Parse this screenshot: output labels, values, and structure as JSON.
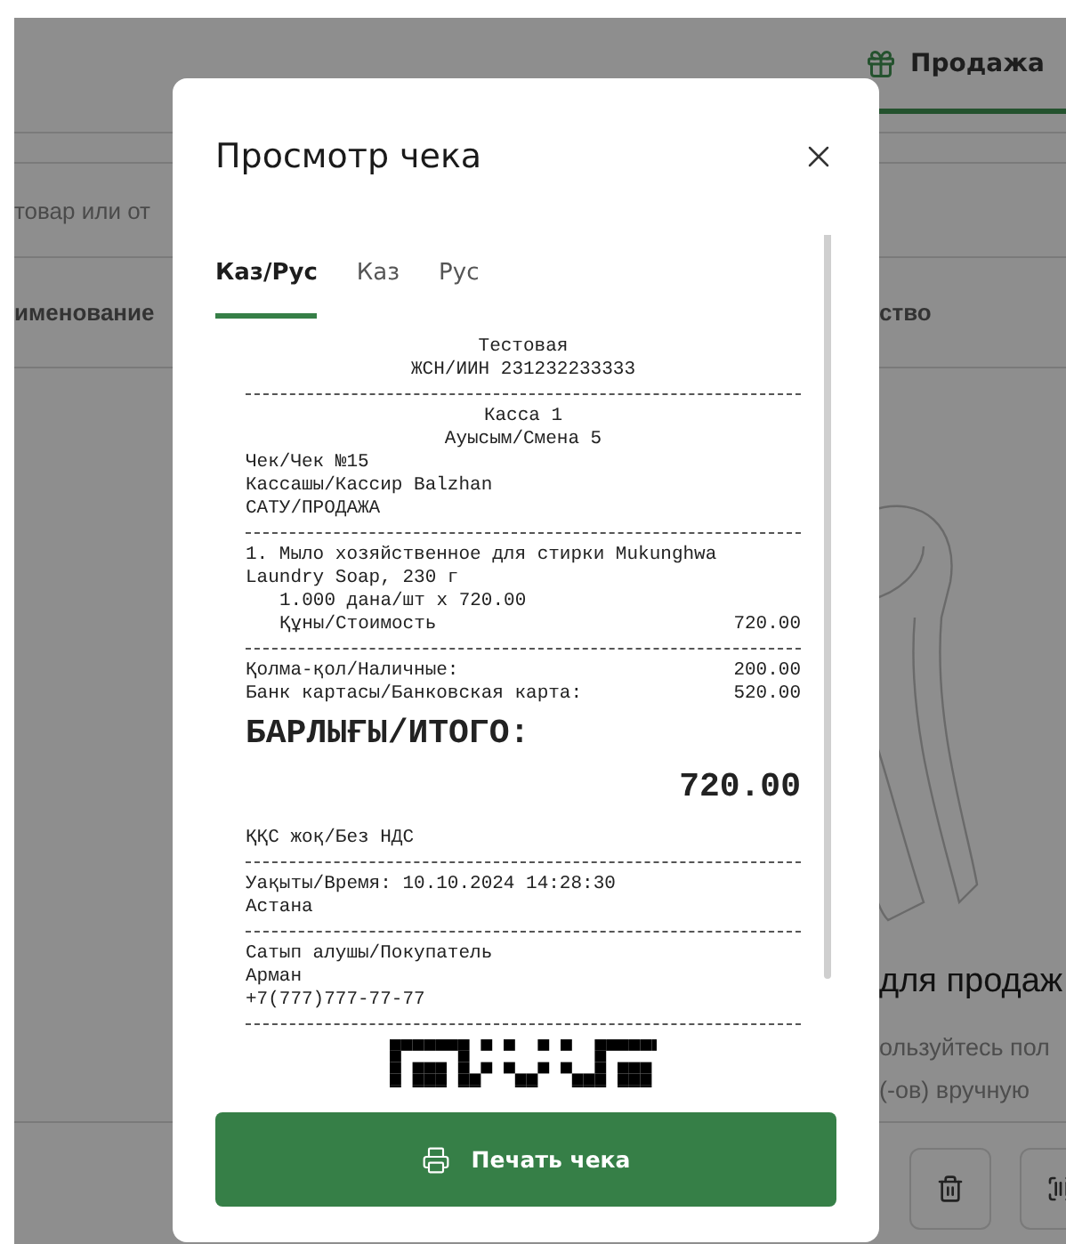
{
  "background": {
    "nav_tab": {
      "label": "Продажа",
      "selected": true
    },
    "search": {
      "placeholder": "товар или от"
    },
    "table": {
      "columns": [
        "именование",
        "ство"
      ]
    },
    "empty_state": {
      "title": "для продаж",
      "lines": [
        "ользуйтесь пол",
        "(-ов) вручную"
      ]
    }
  },
  "dialog": {
    "title": "Просмотр чека",
    "tabs": [
      {
        "label": "Каз/Рус",
        "selected": true
      },
      {
        "label": "Каз",
        "selected": false
      },
      {
        "label": "Рус",
        "selected": false
      }
    ],
    "receipt": [
      {
        "kind": "center",
        "text": "Тестовая"
      },
      {
        "kind": "center",
        "text": "ЖСН/ИИН 231232233333"
      },
      {
        "kind": "divider"
      },
      {
        "kind": "center",
        "text": "Касса 1"
      },
      {
        "kind": "center",
        "text": "Ауысым/Смена 5"
      },
      {
        "kind": "text",
        "text": "Чек/Чек №15"
      },
      {
        "kind": "text",
        "text": "Кассашы/Кассир Balzhan"
      },
      {
        "kind": "text",
        "text": "САТУ/ПРОДАЖА"
      },
      {
        "kind": "divider"
      },
      {
        "kind": "text",
        "text": "1. Мыло хозяйственное для стирки Mukunghwa Laundry Soap, 230 г"
      },
      {
        "kind": "indent",
        "text": "1.000 дана/шт x 720.00"
      },
      {
        "kind": "pair",
        "indent": true,
        "label": "Құны/Стоимость",
        "value": "720.00"
      },
      {
        "kind": "divider"
      },
      {
        "kind": "pair",
        "indent": false,
        "label": "Қолма-қол/Наличные:",
        "value": "200.00"
      },
      {
        "kind": "pair",
        "indent": false,
        "label": "Банк картасы/Банковская карта:",
        "value": "520.00"
      },
      {
        "kind": "total_label",
        "text": "БАРЛЫҒЫ/ИТОГО:"
      },
      {
        "kind": "total_value",
        "text": "720.00"
      },
      {
        "kind": "text",
        "text": "ҚҚС жоқ/Без НДС"
      },
      {
        "kind": "divider"
      },
      {
        "kind": "text",
        "text": "Уақыты/Время: 10.10.2024 14:28:30"
      },
      {
        "kind": "text",
        "text": "Астана"
      },
      {
        "kind": "divider"
      },
      {
        "kind": "text",
        "text": "Сатып алушы/Покупатель"
      },
      {
        "kind": "text",
        "text": "Арман"
      },
      {
        "kind": "text",
        "text": "+7(777)777-77-77"
      },
      {
        "kind": "divider"
      },
      {
        "kind": "qr"
      }
    ],
    "print_button": "Печать чека"
  }
}
